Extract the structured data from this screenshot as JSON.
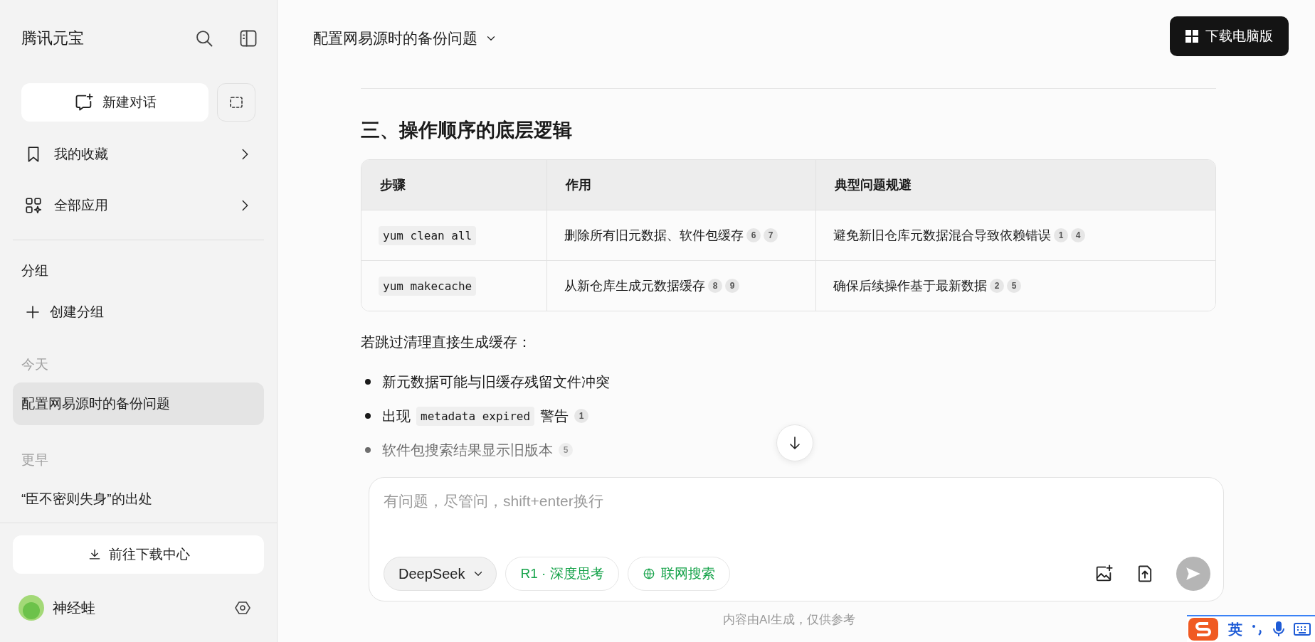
{
  "sidebar": {
    "title": "腾讯元宝",
    "new_chat": "新建对话",
    "nav": [
      {
        "label": "我的收藏",
        "kind": "bookmark"
      },
      {
        "label": "全部应用",
        "kind": "apps"
      }
    ],
    "groups": {
      "heading": "分组",
      "create": "创建分组"
    },
    "history": [
      {
        "heading": "今天",
        "items": [
          {
            "title": "配置网易源时的备份问题",
            "selected": true
          }
        ]
      },
      {
        "heading": "更早",
        "items": [
          {
            "title": "“臣不密则失身”的出处",
            "selected": false
          }
        ]
      }
    ],
    "download_center": "前往下载中心",
    "user": {
      "name": "神经蛙"
    }
  },
  "header": {
    "title": "配置网易源时的备份问题",
    "download_button": "下载电脑版"
  },
  "content": {
    "heading": "三、操作顺序的底层逻辑",
    "table": {
      "columns": [
        "步骤",
        "作用",
        "典型问题规避"
      ],
      "rows": [
        {
          "step": "yum clean all",
          "effect": "删除所有旧元数据、软件包缓存",
          "effect_refs": [
            "6",
            "7"
          ],
          "avoid": "避免新旧仓库元数据混合导致依赖错误",
          "avoid_refs": [
            "1",
            "4"
          ]
        },
        {
          "step": "yum makecache",
          "effect": "从新仓库生成元数据缓存",
          "effect_refs": [
            "8",
            "9"
          ],
          "avoid": "确保后续操作基于最新数据",
          "avoid_refs": [
            "2",
            "5"
          ]
        }
      ]
    },
    "paragraph": "若跳过清理直接生成缓存：",
    "bullets": [
      {
        "segments": [
          {
            "kind": "text",
            "text": "新元数据可能与旧缓存残留文件冲突"
          }
        ]
      },
      {
        "segments": [
          {
            "kind": "text",
            "text": "出现"
          },
          {
            "kind": "code",
            "text": "metadata expired"
          },
          {
            "kind": "text",
            "text": "警告"
          },
          {
            "kind": "ref",
            "text": "1"
          }
        ]
      },
      {
        "segments": [
          {
            "kind": "text",
            "text": "软件包搜索结果显示旧版本"
          },
          {
            "kind": "ref",
            "text": "5"
          }
        ]
      }
    ]
  },
  "composer": {
    "placeholder": "有问题，尽管问，shift+enter换行",
    "model": "DeepSeek",
    "toggles": [
      {
        "label": "R1 · 深度思考",
        "kind": "plain"
      },
      {
        "label": "联网搜索",
        "kind": "web"
      }
    ]
  },
  "footer": "内容由AI生成，仅供参考",
  "ime": {
    "mode": "英"
  }
}
